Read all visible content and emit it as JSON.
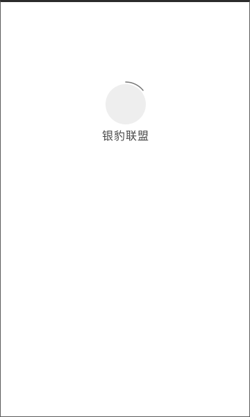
{
  "splash": {
    "app_name": "银豹联盟",
    "loading_icon": "spinner-icon"
  },
  "colors": {
    "background": "#ffffff",
    "disc": "#eeeeee",
    "arc": "#777777",
    "text": "#4a4a4a"
  }
}
